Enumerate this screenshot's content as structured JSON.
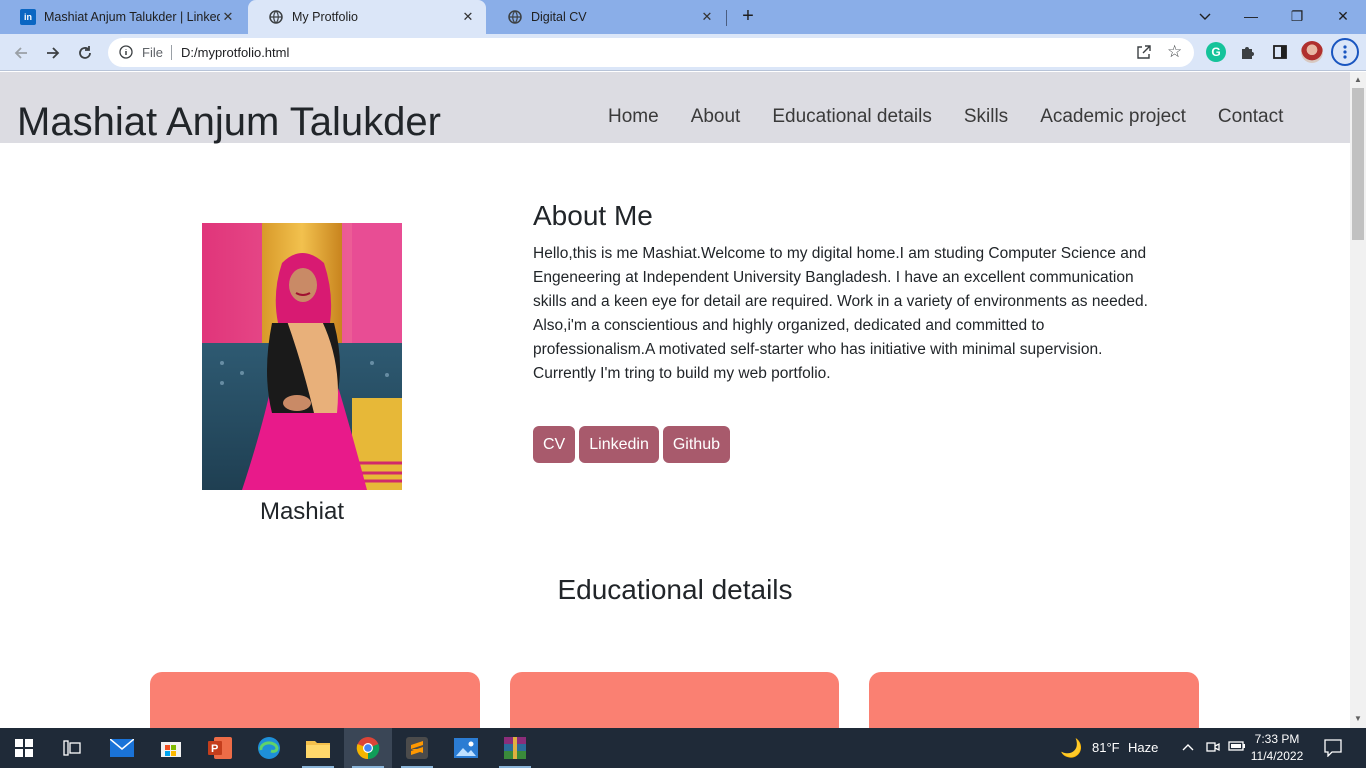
{
  "browser": {
    "tabs": [
      {
        "title": "Mashiat Anjum Talukder | Linkedi",
        "active": false,
        "favicon": "linkedin-icon"
      },
      {
        "title": "My Protfolio",
        "active": true,
        "favicon": "globe-icon"
      },
      {
        "title": "Digital CV",
        "active": false,
        "favicon": "globe-icon"
      }
    ],
    "address": {
      "scheme_label": "File",
      "url": "D:/myprotfolio.html"
    }
  },
  "page": {
    "brand": "Mashiat Anjum Talukder",
    "nav": [
      "Home",
      "About",
      "Educational details",
      "Skills",
      "Academic project",
      "Contact"
    ],
    "profile": {
      "name": "Mashiat"
    },
    "about": {
      "title": "About Me",
      "paragraph": "Hello,this is me Mashiat.Welcome to my digital home.I am studing Computer Science and Engeneering at Independent University Bangladesh. I have an excellent communication skills and a keen eye for detail are required. Work in a variety of environments as needed. Also,i'm a conscientious and highly organized, dedicated and committed to professionalism.A motivated self-starter who has initiative with minimal supervision.",
      "paragraph2": "Currently I'm tring to build my web portfolio.",
      "buttons": [
        "CV",
        "Linkedin",
        "Github"
      ]
    },
    "education": {
      "title": "Educational details"
    },
    "colors": {
      "nav_bg": "#dcdce2",
      "button": "#a85a6c",
      "card": "#fa8072"
    }
  },
  "taskbar": {
    "weather": {
      "temp": "81°F",
      "condition": "Haze"
    },
    "time": "7:33 PM",
    "date": "11/4/2022"
  }
}
